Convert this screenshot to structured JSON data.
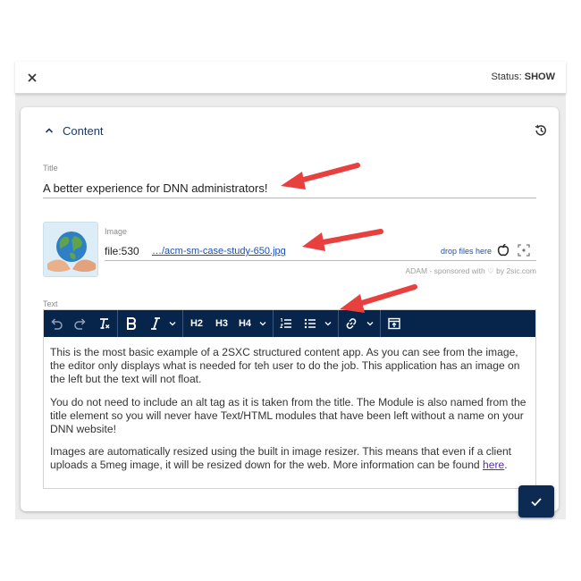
{
  "topbar": {
    "status_label": "Status:",
    "status_value": "SHOW"
  },
  "section": {
    "title": "Content"
  },
  "title_field": {
    "label": "Title",
    "value": "A better experience for DNN administrators!"
  },
  "image_field": {
    "label": "Image",
    "file_id": "file:530",
    "file_link": "…/acm-sm-case-study-650.jpg",
    "drop_label": "drop files here",
    "credit": "ADAM - sponsored with ♡ by 2sic.com"
  },
  "text_field": {
    "label": "Text",
    "toolbar": {
      "h2": "H2",
      "h3": "H3",
      "h4": "H4"
    },
    "paragraphs": [
      "This is the most basic example of a 2SXC structured content app. As you can see from the image, the editor only displays what is needed for teh user to do the job. This application has an image on the left but the text will not float.",
      "You do not need to include an alt tag as it is taken from the title. The Module is also named from the title element so you will never have Text/HTML modules that have been left without a name on your DNN website!",
      "Images are automatically resized using the built in image resizer. This means that even if a client uploads a 5meg image, it will be resized down for the web. More information can be found "
    ],
    "link_text": "here",
    "link_suffix": "."
  },
  "colors": {
    "toolbar_bg": "#07254b",
    "accent": "#1d3a63",
    "arrow": "#e8403f",
    "link": "#1a4fb8"
  },
  "icons": [
    "close-icon",
    "chevron-up-icon",
    "history-icon",
    "apple-icon",
    "focus-icon",
    "undo-icon",
    "redo-icon",
    "clear-format-icon",
    "bold-icon",
    "italic-icon",
    "numbered-list-icon",
    "bullet-list-icon",
    "link-icon",
    "page-icon",
    "check-icon"
  ]
}
